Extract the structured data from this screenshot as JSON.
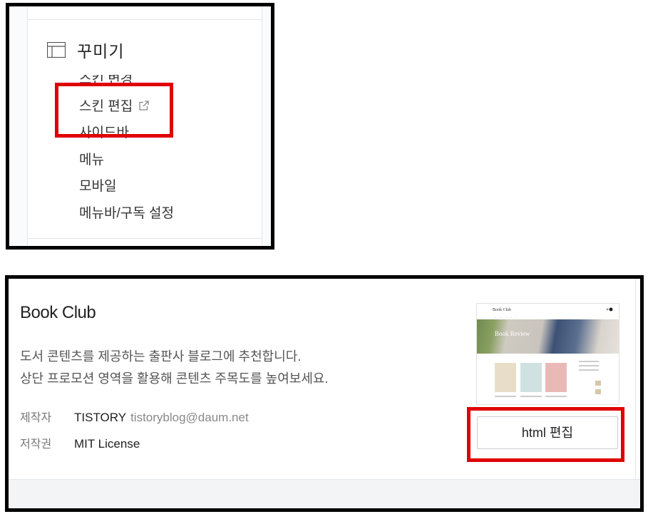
{
  "sidebar": {
    "section_title": "꾸미기",
    "section_icon": "layout-icon",
    "items": [
      {
        "label": "스킨 변경"
      },
      {
        "label": "스킨 편집",
        "icon": "external-link-icon"
      },
      {
        "label": "사이드바"
      },
      {
        "label": "메뉴"
      },
      {
        "label": "모바일"
      },
      {
        "label": "메뉴바/구독 설정"
      }
    ]
  },
  "skin": {
    "name": "Book Club",
    "description_lines": [
      "도서 콘텐츠를 제공하는 출판사 블로그에 추천합니다.",
      "상단 프로모션 영역을 활용해 콘텐츠 주목도를 높여보세요."
    ],
    "author_label": "제작자",
    "author_name": "TISTORY",
    "author_email": "tistoryblog@daum.net",
    "license_label": "저작권",
    "license_value": "MIT License",
    "edit_button_label": "html 편집",
    "thumbnail": {
      "blog_title": "Book Club",
      "hero_text": "Book Review"
    }
  },
  "colors": {
    "highlight": "#e00000",
    "panel_border": "#000000"
  }
}
